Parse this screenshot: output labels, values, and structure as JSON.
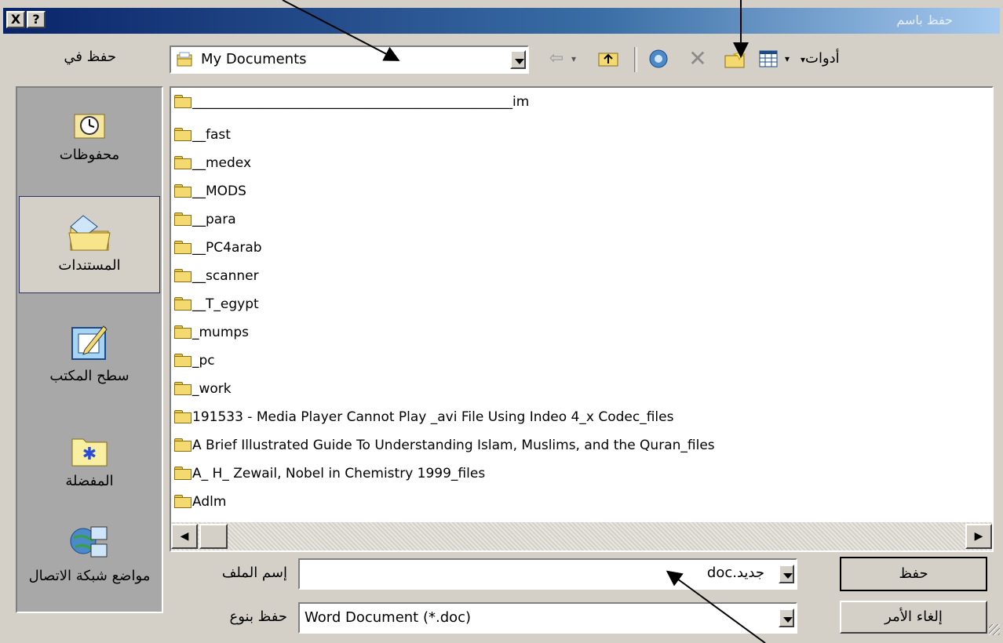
{
  "window": {
    "title": "حفظ باسم",
    "help_btn": "?",
    "close_btn": "X"
  },
  "toolbar": {
    "save_in_label": "حفظ في",
    "location": "My Documents",
    "tools_label": "أدوات"
  },
  "places": [
    {
      "label": "محفوظات",
      "icon": "history-icon"
    },
    {
      "label": "المستندات",
      "icon": "my-documents-icon"
    },
    {
      "label": "سطح المكتب",
      "icon": "desktop-icon"
    },
    {
      "label": "المفضلة",
      "icon": "favorites-icon"
    },
    {
      "label": "مواضع شبكة الاتصال",
      "icon": "network-places-icon"
    }
  ],
  "files": [
    "________________________________________________im",
    "__fast",
    "__medex",
    "__MODS",
    "__para",
    "__PC4arab",
    "__scanner",
    "__T_egypt",
    "_mumps",
    "_pc",
    "_work",
    "191533 - Media Player Cannot Play _avi File Using Indeo 4_x Codec_files",
    "A Brief Illustrated Guide To Understanding Islam, Muslims, and the Quran_files",
    "A_ H_ Zewail, Nobel in Chemistry 1999_files",
    "Adlm"
  ],
  "filename": {
    "label": "إسم الملف",
    "value": "جديد.doc"
  },
  "filetype": {
    "label": "حفظ بنوع",
    "value": "Word Document (*.doc)"
  },
  "buttons": {
    "save": "حفظ",
    "cancel": "إلغاء الأمر"
  }
}
